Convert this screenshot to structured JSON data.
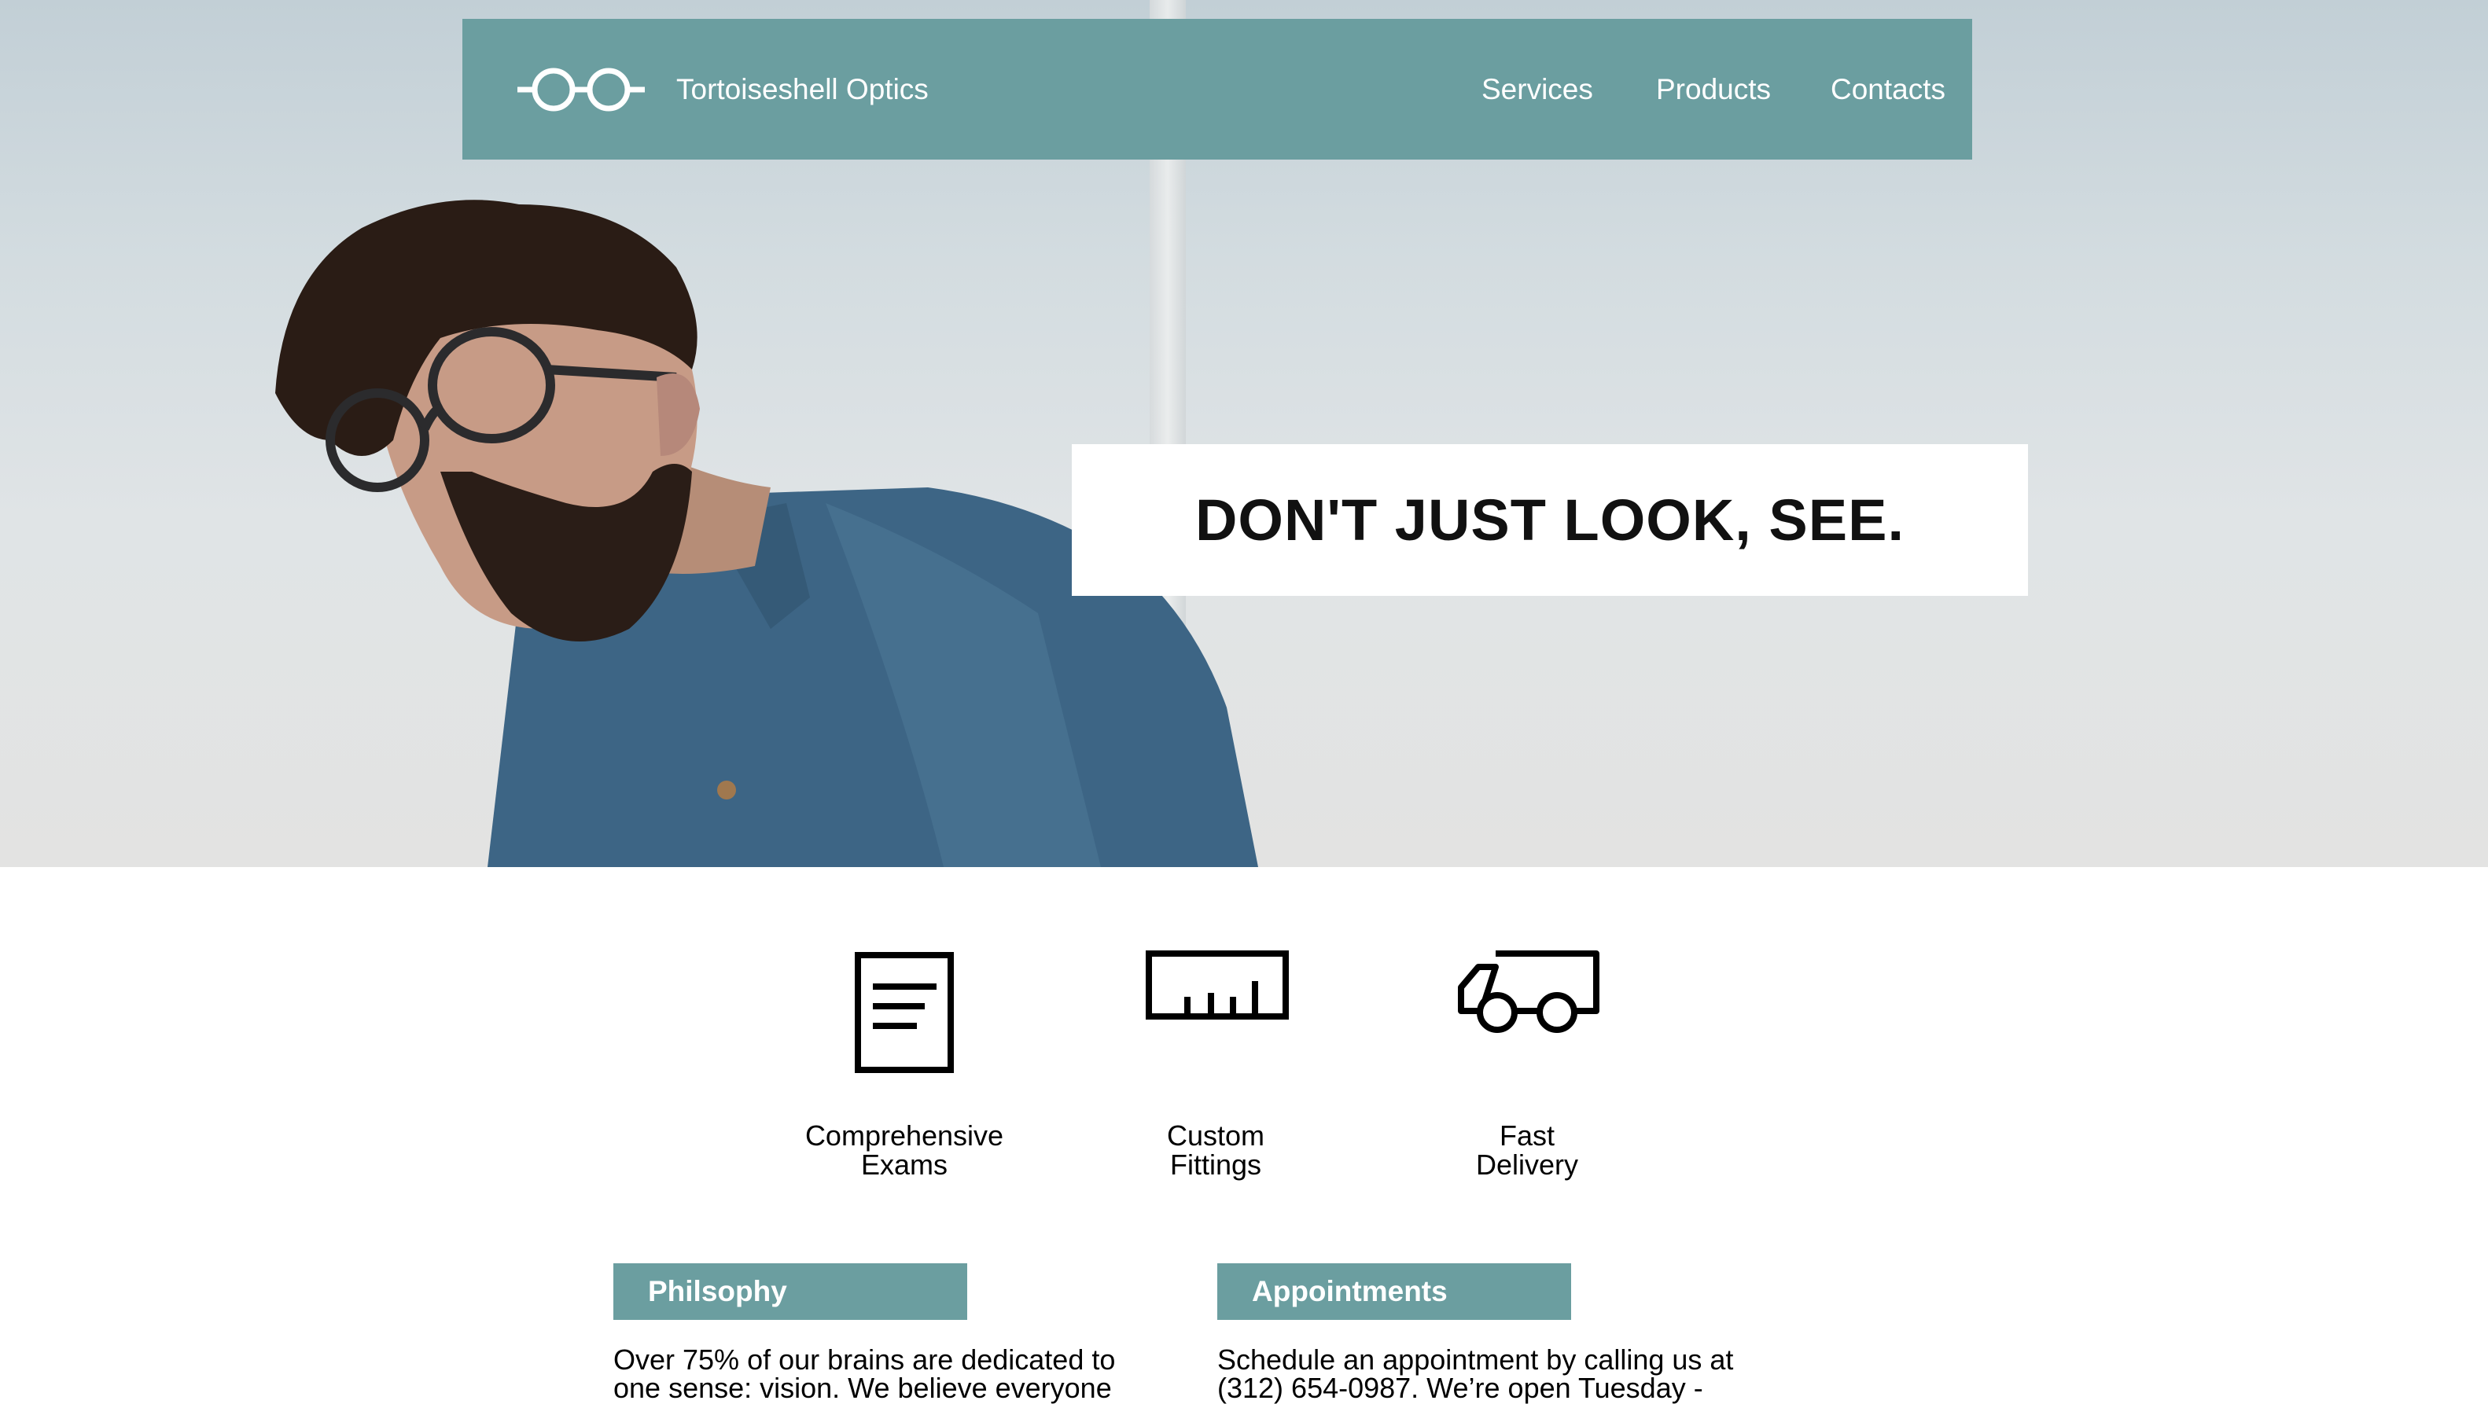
{
  "header": {
    "brand": "Tortoiseshell Optics",
    "nav": [
      "Services",
      "Products",
      "Contacts"
    ]
  },
  "hero": {
    "tagline": "DON'T JUST LOOK, SEE."
  },
  "features": [
    {
      "icon": "document-icon",
      "line1": "Comprehensive",
      "line2": "Exams"
    },
    {
      "icon": "ruler-icon",
      "line1": "Custom",
      "line2": "Fittings"
    },
    {
      "icon": "truck-icon",
      "line1": "Fast",
      "line2": "Delivery"
    }
  ],
  "sections": {
    "philosophy": {
      "title": "Philsophy",
      "line1": "Over 75% of our brains are dedicated to",
      "line2": "one sense: vision. We believe everyone"
    },
    "appointments": {
      "title": "Appointments",
      "line1": "Schedule an appointment by calling us at",
      "line2": "(312) 654-0987. We’re open Tuesday -"
    }
  },
  "colors": {
    "accent": "#6b9ea0",
    "nav_text": "#ffffff",
    "tagline_bg": "#ffffff"
  }
}
